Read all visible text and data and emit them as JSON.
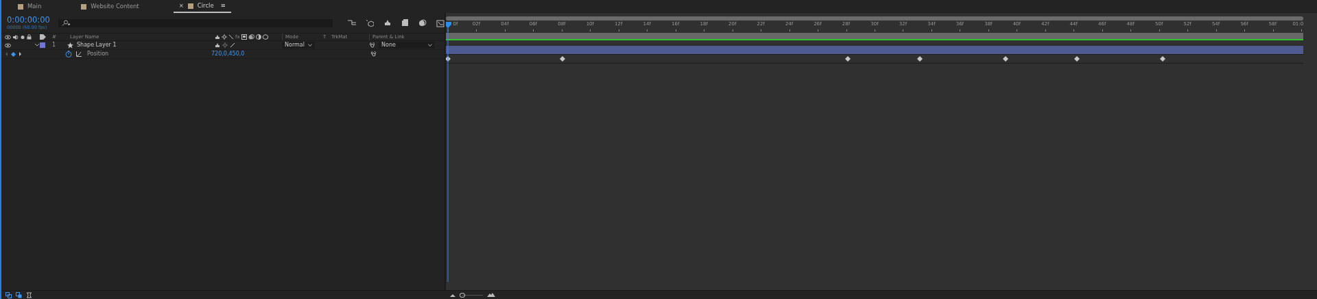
{
  "tabs": [
    {
      "label": "Main",
      "color": "#b49e80",
      "selected": false
    },
    {
      "label": "Website Content",
      "color": "#b49e80",
      "selected": false
    },
    {
      "label": "Circle",
      "color": "#b49e80",
      "selected": true,
      "close": "×",
      "menu": "≡"
    }
  ],
  "timecode": "0:00:00:00",
  "frame_info": "00000 (60.00 fps)",
  "columns": {
    "fx": "fx",
    "number": "#",
    "layer_name": "Layer Name",
    "mode": "Mode",
    "t": "T",
    "trkmat": "TrkMat",
    "parent": "Parent & Link"
  },
  "layers": [
    {
      "number": "1",
      "name": "Shape Layer 1",
      "color": "#6f76d8",
      "expanded": true,
      "visible": true,
      "mode": "Normal",
      "parent": "None",
      "properties": [
        {
          "name": "Position",
          "value": "720,0,450,0",
          "stopwatch": true,
          "keyframes": [
            {
              "level": 0
            },
            {
              "level": 0.1333
            },
            {
              "level": 0.4667
            },
            {
              "level": 0.55
            },
            {
              "level": 0.65
            },
            {
              "level": 0.7333
            },
            {
              "level": 0.8333
            }
          ]
        }
      ]
    }
  ],
  "ruler": {
    "ticks": [
      "0f",
      "02f",
      "04f",
      "06f",
      "08f",
      "10f",
      "12f",
      "14f",
      "16f",
      "18f",
      "20f",
      "22f",
      "24f",
      "26f",
      "28f",
      "30f",
      "32f",
      "34f",
      "36f",
      "38f",
      "40f",
      "42f",
      "44f",
      "46f",
      "48f",
      "50f",
      "52f",
      "54f",
      "56f",
      "58f",
      "01:0"
    ]
  },
  "playhead": {
    "level": 0
  },
  "zoom": {
    "level": 0
  }
}
